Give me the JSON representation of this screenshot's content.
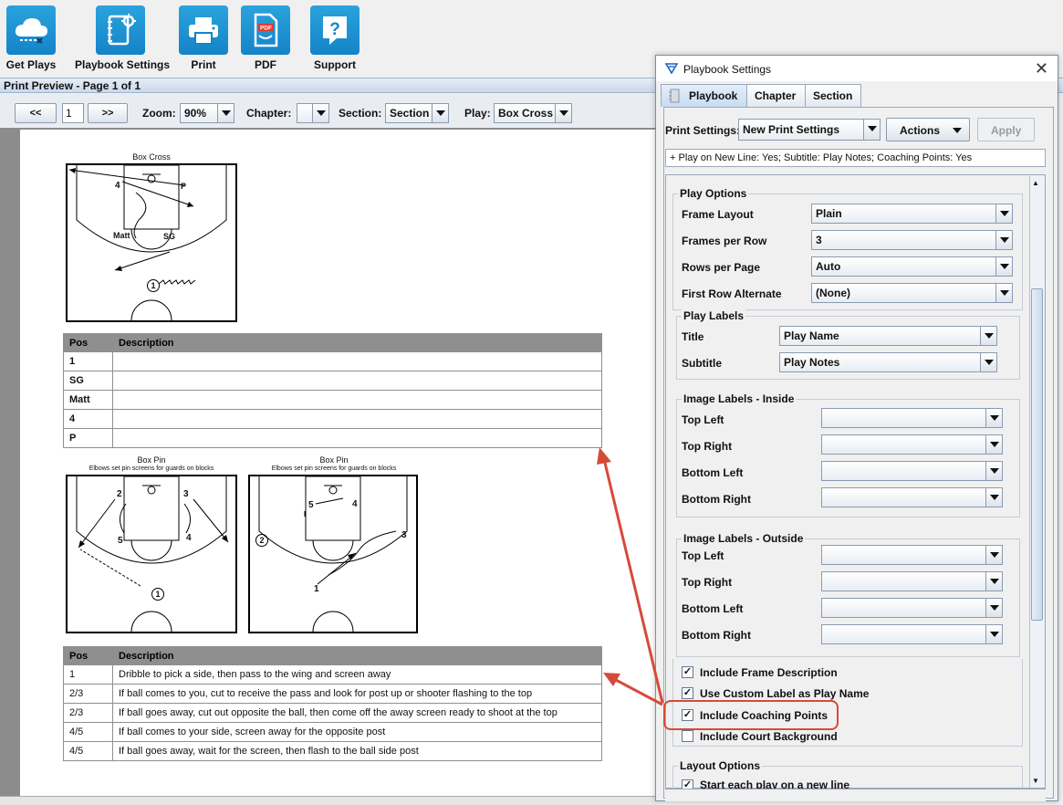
{
  "toolbar": {
    "buttons": [
      {
        "label": "Get Plays",
        "icon": "cloud-download-icon"
      },
      {
        "label": "Playbook Settings",
        "icon": "notebook-gear-icon"
      },
      {
        "label": "Print",
        "icon": "printer-icon"
      },
      {
        "label": "PDF",
        "icon": "pdf-file-icon"
      },
      {
        "label": "Support",
        "icon": "help-question-icon"
      }
    ]
  },
  "preview": {
    "header": "Print Preview  - Page 1 of 1",
    "prev_label": "<<",
    "next_label": ">>",
    "page_value": "1",
    "zoom_label": "Zoom:",
    "zoom_value": "90%",
    "chapter_label": "Chapter:",
    "chapter_value": "",
    "section_label": "Section:",
    "section_value": "Section",
    "play_label": "Play:",
    "play_value": "Box Cross"
  },
  "page": {
    "play1": {
      "title": "Box Cross",
      "players": [
        "4",
        "P",
        "Matt",
        "SG",
        "1"
      ],
      "table_headers": [
        "Pos",
        "Description"
      ],
      "rows": [
        {
          "pos": "1",
          "desc": ""
        },
        {
          "pos": "SG",
          "desc": ""
        },
        {
          "pos": "Matt",
          "desc": ""
        },
        {
          "pos": "4",
          "desc": ""
        },
        {
          "pos": "P",
          "desc": ""
        }
      ]
    },
    "play2": {
      "frame1": {
        "title": "Box Pin",
        "subtitle": "Elbows set pin screens for guards on blocks",
        "players": [
          "2",
          "3",
          "5",
          "4",
          "1"
        ]
      },
      "frame2": {
        "title": "Box Pin",
        "subtitle": "Elbows set pin screens for guards on blocks",
        "players": [
          "5",
          "4",
          "2",
          "3",
          "1"
        ]
      },
      "table_headers": [
        "Pos",
        "Description"
      ],
      "rows": [
        {
          "pos": "1",
          "desc": "Dribble to pick a side, then pass to the wing and screen away"
        },
        {
          "pos": "2/3",
          "desc": "If ball comes to you, cut to receive the pass and look for post up or shooter flashing to the top"
        },
        {
          "pos": "2/3",
          "desc": "If ball goes away, cut out opposite the ball, then come off the away screen ready to shoot at the top"
        },
        {
          "pos": "4/5",
          "desc": "If ball comes to your side, screen away for the opposite post"
        },
        {
          "pos": "4/5",
          "desc": "If ball goes away, wait for the screen, then flash to the ball side post"
        }
      ]
    }
  },
  "dialog": {
    "title": "Playbook Settings",
    "tabs": [
      "Playbook",
      "Chapter",
      "Section"
    ],
    "print_settings_label": "Print Settings:",
    "print_settings_value": "New Print Settings",
    "actions_label": "Actions",
    "apply_label": "Apply",
    "summary": "+ Play on New Line: Yes; Subtitle: Play Notes; Coaching Points: Yes",
    "play_options": {
      "title": "Play Options",
      "fields": [
        {
          "label": "Frame Layout",
          "value": "Plain"
        },
        {
          "label": "Frames per Row",
          "value": "3"
        },
        {
          "label": "Rows per Page",
          "value": "Auto"
        },
        {
          "label": "First Row Alternate",
          "value": "(None)"
        }
      ]
    },
    "play_labels": {
      "title": "Play Labels",
      "fields": [
        {
          "label": "Title",
          "value": "Play Name"
        },
        {
          "label": "Subtitle",
          "value": "Play Notes"
        }
      ]
    },
    "image_inside": {
      "title": "Image Labels - Inside",
      "fields": [
        {
          "label": "Top Left",
          "value": ""
        },
        {
          "label": "Top Right",
          "value": ""
        },
        {
          "label": "Bottom Left",
          "value": ""
        },
        {
          "label": "Bottom Right",
          "value": ""
        }
      ]
    },
    "image_outside": {
      "title": "Image Labels - Outside",
      "fields": [
        {
          "label": "Top Left",
          "value": ""
        },
        {
          "label": "Top Right",
          "value": ""
        },
        {
          "label": "Bottom Left",
          "value": ""
        },
        {
          "label": "Bottom Right",
          "value": ""
        }
      ]
    },
    "checkboxes": [
      {
        "label": "Include Frame Description",
        "checked": true
      },
      {
        "label": "Use Custom Label as Play Name",
        "checked": true
      },
      {
        "label": "Include Coaching Points",
        "checked": true
      },
      {
        "label": "Include Court Background",
        "checked": false
      }
    ],
    "layout_options": {
      "title": "Layout Options",
      "checkbox": {
        "label": "Start each play on a new line",
        "checked": true
      }
    }
  },
  "colors": {
    "toolbar_tile": "#1e93d3",
    "annotation": "#d64a3a",
    "table_header": "#8f8f8f"
  }
}
